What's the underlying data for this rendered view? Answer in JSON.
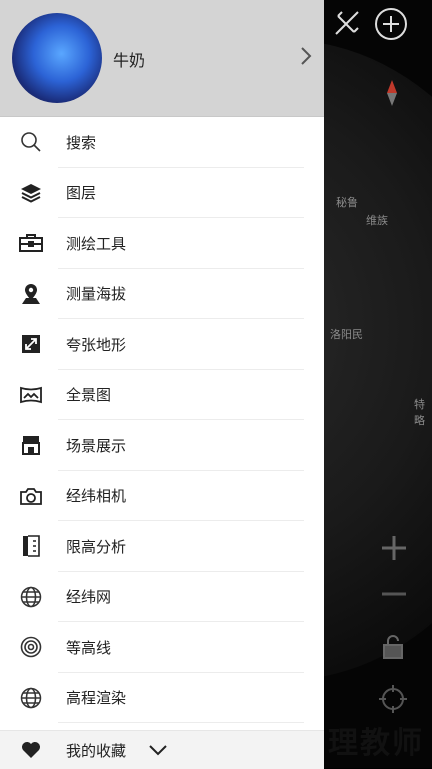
{
  "profile": {
    "username": "牛奶"
  },
  "menu": [
    {
      "label": "搜索",
      "icon": "search-icon"
    },
    {
      "label": "图层",
      "icon": "layers-icon"
    },
    {
      "label": "测绘工具",
      "icon": "toolbox-icon"
    },
    {
      "label": "测量海拔",
      "icon": "location-pin-icon"
    },
    {
      "label": "夸张地形",
      "icon": "expand-icon"
    },
    {
      "label": "全景图",
      "icon": "panorama-icon"
    },
    {
      "label": "场景展示",
      "icon": "shop-icon"
    },
    {
      "label": "经纬相机",
      "icon": "camera-icon"
    },
    {
      "label": "限高分析",
      "icon": "height-limit-icon"
    },
    {
      "label": "经纬网",
      "icon": "globe-icon"
    },
    {
      "label": "等高线",
      "icon": "contour-icon"
    },
    {
      "label": "高程渲染",
      "icon": "globe-icon"
    }
  ],
  "favorites": {
    "label": "我的收藏",
    "icon": "heart-icon"
  },
  "map": {
    "labels": [
      "秘鲁",
      "维族",
      "洛阳民",
      "特略"
    ],
    "watermark": "理教师"
  }
}
